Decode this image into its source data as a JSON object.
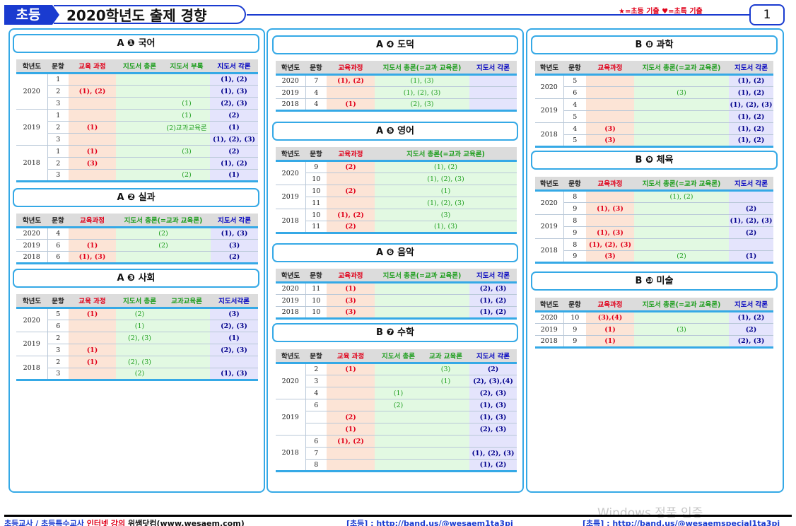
{
  "header": {
    "tag": "초등",
    "title": "2020학년도 출제 경향",
    "legend": "★=초등 기출  ♥=초특 기출",
    "page": "1"
  },
  "sections": {
    "korean": {
      "title": "A ❶ 국어",
      "headers": [
        "학년도",
        "문항",
        "교육 과정",
        "지도서 총론",
        "지도서 부록",
        "지도서 각론"
      ],
      "rows": [
        {
          "y": "2020",
          "n": "1",
          "c": [
            "",
            "",
            "",
            "(1), (2)"
          ]
        },
        {
          "y": "",
          "n": "2",
          "c": [
            "(1), (2)",
            "",
            "",
            "(1), (3)"
          ]
        },
        {
          "y": "",
          "n": "3",
          "c": [
            "",
            "",
            "(1)",
            "(2), (3)"
          ]
        },
        {
          "y": "2019",
          "n": "1",
          "c": [
            "",
            "",
            "(1)",
            "(2)"
          ]
        },
        {
          "y": "",
          "n": "2",
          "c": [
            "(1)",
            "",
            "(2)교과교육론",
            "(1)"
          ]
        },
        {
          "y": "",
          "n": "3",
          "c": [
            "",
            "",
            "",
            "(1), (2), (3)"
          ]
        },
        {
          "y": "2018",
          "n": "1",
          "c": [
            "(1)",
            "",
            "(3)",
            "(2)"
          ]
        },
        {
          "y": "",
          "n": "2",
          "c": [
            "(3)",
            "",
            "",
            "(1), (2)"
          ]
        },
        {
          "y": "",
          "n": "3",
          "c": [
            "",
            "",
            "(2)",
            "(1)"
          ]
        }
      ]
    },
    "practical": {
      "title": "A ❷ 실과",
      "headers": [
        "학년도",
        "문항",
        "교육과정",
        "지도서 총론(=교과 교육론)",
        "지도서 각론"
      ],
      "rows": [
        {
          "y": "2020",
          "n": "4",
          "c": [
            "",
            "(2)",
            "(1), (3)"
          ]
        },
        {
          "y": "2019",
          "n": "6",
          "c": [
            "(1)",
            "(2)",
            "(3)"
          ]
        },
        {
          "y": "2018",
          "n": "6",
          "c": [
            "(1), (3)",
            "",
            "(2)"
          ]
        }
      ]
    },
    "social": {
      "title": "A ❸ 사회",
      "headers": [
        "학년도",
        "문항",
        "교육 과정",
        "지도서 총론",
        "교과교육론",
        "지도서각론"
      ],
      "rows": [
        {
          "y": "2020",
          "n": "5",
          "c": [
            "(1)",
            "(2)",
            "",
            "(3)"
          ]
        },
        {
          "y": "",
          "n": "6",
          "c": [
            "",
            "(1)",
            "",
            "(2), (3)"
          ]
        },
        {
          "y": "2019",
          "n": "2",
          "c": [
            "",
            "(2), (3)",
            "",
            "(1)"
          ]
        },
        {
          "y": "",
          "n": "3",
          "c": [
            "(1)",
            "",
            "",
            "(2), (3)"
          ]
        },
        {
          "y": "2018",
          "n": "2",
          "c": [
            "(1)",
            "(2), (3)",
            "",
            ""
          ]
        },
        {
          "y": "",
          "n": "3",
          "c": [
            "",
            "(2)",
            "",
            "(1), (3)"
          ]
        }
      ]
    },
    "ethics": {
      "title": "A ❹ 도덕",
      "headers": [
        "학년도",
        "문항",
        "교육과정",
        "지도서 총론(=교과 교육론)",
        "지도서 각론"
      ],
      "rows": [
        {
          "y": "2020",
          "n": "7",
          "c": [
            "(1), (2)",
            "(1), (3)",
            ""
          ]
        },
        {
          "y": "2019",
          "n": "4",
          "c": [
            "",
            "(1), (2), (3)",
            ""
          ]
        },
        {
          "y": "2018",
          "n": "4",
          "c": [
            "(1)",
            "(2), (3)",
            ""
          ]
        }
      ]
    },
    "english": {
      "title": "A ❺ 영어",
      "headers": [
        "학년도",
        "문항",
        "교육과정",
        "지도서 총론(=교과 교육론)"
      ],
      "rows": [
        {
          "y": "2020",
          "n": "9",
          "c": [
            "(2)",
            "(1), (2)"
          ]
        },
        {
          "y": "",
          "n": "10",
          "c": [
            "",
            "(1), (2), (3)"
          ]
        },
        {
          "y": "2019",
          "n": "10",
          "c": [
            "(2)",
            "(1)"
          ]
        },
        {
          "y": "",
          "n": "11",
          "c": [
            "",
            "(1), (2), (3)"
          ]
        },
        {
          "y": "2018",
          "n": "10",
          "c": [
            "(1), (2)",
            "(3)"
          ]
        },
        {
          "y": "",
          "n": "11",
          "c": [
            "(2)",
            "(1), (3)"
          ]
        }
      ]
    },
    "music": {
      "title": "A ❻ 음악",
      "headers": [
        "학년도",
        "문항",
        "교육과정",
        "지도서 총론(=교과 교육론)",
        "지도서 각론"
      ],
      "rows": [
        {
          "y": "2020",
          "n": "11",
          "c": [
            "(1)",
            "",
            "(2), (3)"
          ]
        },
        {
          "y": "2019",
          "n": "10",
          "c": [
            "(3)",
            "",
            "(1), (2)"
          ]
        },
        {
          "y": "2018",
          "n": "10",
          "c": [
            "(3)",
            "",
            "(1), (2)"
          ]
        }
      ]
    },
    "math": {
      "title": "B ❼ 수학",
      "headers": [
        "학년도",
        "문항",
        "교육 과정",
        "지도서 총론",
        "교과 교육론",
        "지도서 각론"
      ],
      "rows": [
        {
          "y": "2020",
          "n": "2",
          "c": [
            "(1)",
            "",
            "(3)",
            "(2)"
          ]
        },
        {
          "y": "",
          "n": "3",
          "c": [
            "",
            "",
            "(1)",
            "(2), (3),(4)"
          ]
        },
        {
          "y": "",
          "n": "4",
          "c": [
            "",
            "(1)",
            "",
            "(2), (3)"
          ]
        },
        {
          "y": "2019",
          "n": "6",
          "c": [
            "",
            "(2)",
            "",
            "(1), (3)"
          ]
        },
        {
          "y": "",
          "n": "",
          "c": [
            "(2)",
            "",
            "",
            "(1), (3)"
          ]
        },
        {
          "y": "",
          "n": "",
          "c": [
            "(1)",
            "",
            "",
            "(2), (3)"
          ]
        },
        {
          "y": "2018",
          "n": "6",
          "c": [
            "(1), (2)",
            "",
            "",
            ""
          ]
        },
        {
          "y": "",
          "n": "7",
          "c": [
            "",
            "",
            "",
            "(1), (2), (3)"
          ]
        },
        {
          "y": "",
          "n": "8",
          "c": [
            "",
            "",
            "",
            "(1), (2)"
          ]
        }
      ]
    },
    "science": {
      "title": "B ❽ 과학",
      "headers": [
        "학년도",
        "문항",
        "교육과정",
        "지도서 총론(=교과 교육론)",
        "지도서 각론"
      ],
      "rows": [
        {
          "y": "2020",
          "n": "5",
          "c": [
            "",
            "",
            "(1), (2)"
          ]
        },
        {
          "y": "",
          "n": "6",
          "c": [
            "",
            "(3)",
            "(1), (2)"
          ]
        },
        {
          "y": "2019",
          "n": "4",
          "c": [
            "",
            "",
            "(1), (2), (3)"
          ]
        },
        {
          "y": "",
          "n": "5",
          "c": [
            "",
            "",
            "(1), (2)"
          ]
        },
        {
          "y": "2018",
          "n": "4",
          "c": [
            "(3)",
            "",
            "(1), (2)"
          ]
        },
        {
          "y": "",
          "n": "5",
          "c": [
            "(3)",
            "",
            "(1), (2)"
          ]
        }
      ]
    },
    "pe": {
      "title": "B ❾ 체육",
      "headers": [
        "학년도",
        "문항",
        "교육과정",
        "지도서 총론(=교과 교육론)",
        "지도서 각론"
      ],
      "rows": [
        {
          "y": "2020",
          "n": "8",
          "c": [
            "",
            "(1), (2)",
            ""
          ]
        },
        {
          "y": "",
          "n": "9",
          "c": [
            "(1), (3)",
            "",
            "(2)"
          ]
        },
        {
          "y": "2019",
          "n": "8",
          "c": [
            "",
            "",
            "(1), (2), (3)"
          ]
        },
        {
          "y": "",
          "n": "9",
          "c": [
            "(1), (3)",
            "",
            "(2)"
          ]
        },
        {
          "y": "2018",
          "n": "8",
          "c": [
            "(1), (2), (3)",
            "",
            ""
          ]
        },
        {
          "y": "",
          "n": "9",
          "c": [
            "(3)",
            "(2)",
            "(1)"
          ]
        }
      ]
    },
    "art": {
      "title": "B ❿ 미술",
      "headers": [
        "학년도",
        "문항",
        "교육과정",
        "지도서 총론(=교과 교육론)",
        "지도서 각론"
      ],
      "rows": [
        {
          "y": "2020",
          "n": "10",
          "c": [
            "(3),(4)",
            "",
            "(1), (2)"
          ]
        },
        {
          "y": "2019",
          "n": "9",
          "c": [
            "(1)",
            "(3)",
            "(2)"
          ]
        },
        {
          "y": "2018",
          "n": "9",
          "c": [
            "(1)",
            "",
            "(2), (3)"
          ]
        }
      ]
    }
  },
  "footer": {
    "left_prefix": "초등교사 / 초등특수교사 ",
    "left_red": "인터넷 강의",
    "left_site": " 위쌤닷컴(www.wesaem.com)",
    "mid": "[초등] :  http://band.us/@wesaem1ta3pi",
    "right": "[초특] : http://band.us/@wesaemspecial1ta3pi"
  },
  "watermark": "Windows 정품 인증"
}
